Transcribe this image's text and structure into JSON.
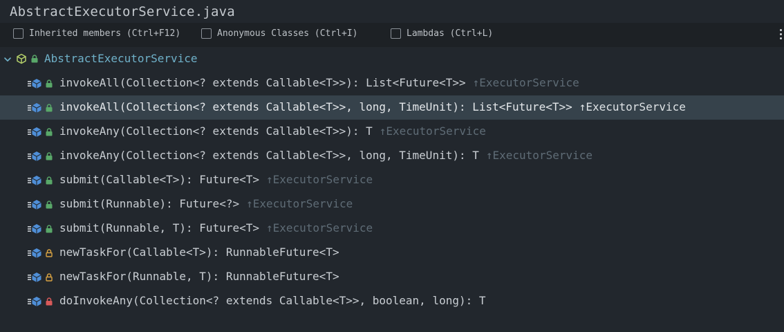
{
  "title": "AbstractExecutorService.java",
  "options": [
    {
      "label": "Inherited members (Ctrl+F12)",
      "checked": false
    },
    {
      "label": "Anonymous Classes (Ctrl+I)",
      "checked": false
    },
    {
      "label": "Lambdas (Ctrl+L)",
      "checked": false
    }
  ],
  "root": {
    "label": "AbstractExecutorService",
    "expanded": true,
    "icon": "class-icon"
  },
  "members": [
    {
      "signature": "invokeAll(Collection<? extends Callable<T>>): List<Future<T>>",
      "inherited": "↑ExecutorService",
      "access": "public",
      "selected": false
    },
    {
      "signature": "invokeAll(Collection<? extends Callable<T>>, long, TimeUnit): List<Future<T>>",
      "inherited": "↑ExecutorService",
      "access": "public",
      "selected": true
    },
    {
      "signature": "invokeAny(Collection<? extends Callable<T>>): T",
      "inherited": "↑ExecutorService",
      "access": "public",
      "selected": false
    },
    {
      "signature": "invokeAny(Collection<? extends Callable<T>>, long, TimeUnit): T",
      "inherited": "↑ExecutorService",
      "access": "public",
      "selected": false
    },
    {
      "signature": "submit(Callable<T>): Future<T>",
      "inherited": "↑ExecutorService",
      "access": "public",
      "selected": false
    },
    {
      "signature": "submit(Runnable): Future<?>",
      "inherited": "↑ExecutorService",
      "access": "public",
      "selected": false
    },
    {
      "signature": "submit(Runnable, T): Future<T>",
      "inherited": "↑ExecutorService",
      "access": "public",
      "selected": false
    },
    {
      "signature": "newTaskFor(Callable<T>): RunnableFuture<T>",
      "inherited": "",
      "access": "protected",
      "selected": false
    },
    {
      "signature": "newTaskFor(Runnable, T): RunnableFuture<T>",
      "inherited": "",
      "access": "protected",
      "selected": false
    },
    {
      "signature": "doInvokeAny(Collection<? extends Callable<T>>, boolean, long): T",
      "inherited": "",
      "access": "private",
      "selected": false
    }
  ],
  "colors": {
    "public": "#59a869",
    "protected": "#d9a343",
    "private": "#d95a5a",
    "method": "#4f8fd8",
    "class": "#b3cf6a"
  }
}
